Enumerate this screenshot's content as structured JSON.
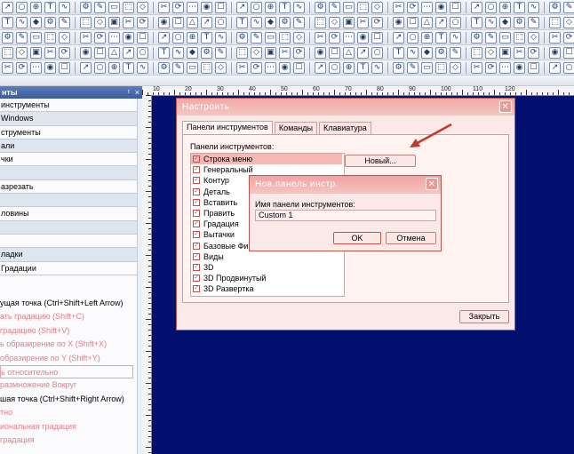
{
  "toolbars": [
    {
      "row": 1,
      "icons": [
        "drawing-icon",
        "arrow-icon",
        "circle-icon",
        "globe-icon",
        "text-icon",
        "wave-icon",
        "bucket-icon",
        "link-icon",
        "curve-icon"
      ]
    },
    {
      "row": 2,
      "icons": [
        "brush-icon",
        "pen-icon",
        "shape-icon",
        "pencil-icon",
        "grid-icon",
        "select-icon"
      ]
    },
    {
      "row": 3,
      "icons": [
        "film-icon",
        "layers-icon",
        "export-icon",
        "grid-icon",
        "star-icon"
      ]
    },
    {
      "row": 4,
      "icons": [
        "cross-icon",
        "table-icon",
        "window-icon",
        "frame-icon"
      ]
    }
  ],
  "left_panel": {
    "header": "нты",
    "pin": "ᵗ",
    "close": "×",
    "rows": [
      {
        "label": "инструменты"
      },
      {
        "label": "Windows"
      },
      {
        "label": "струменты"
      },
      {
        "label": "али"
      },
      {
        "label": "чки"
      },
      {
        "label": ""
      },
      {
        "label": "азрезать"
      },
      {
        "label": ""
      },
      {
        "label": "ловины"
      },
      {
        "label": ""
      },
      {
        "label": ""
      },
      {
        "label": "ладки"
      },
      {
        "label": "Градации"
      }
    ],
    "commands": [
      {
        "label": "ущая точка (Ctrl+Shift+Left Arrow)",
        "state": "normal"
      },
      {
        "label": "ать градацию (Shift+C)",
        "state": "dim"
      },
      {
        "label": "градацию (Shift+V)",
        "state": "dim"
      },
      {
        "label": "ь образирение по X (Shift+X)",
        "state": "dim"
      },
      {
        "label": "образирение по Y (Shift+Y)",
        "state": "dim"
      },
      {
        "label": "ь относительно",
        "state": "selected"
      },
      {
        "label": "размножение Вокруг",
        "state": "dim"
      },
      {
        "label": "шая точка (Ctrl+Shift+Right Arrow)",
        "state": "normal"
      },
      {
        "label": "тно",
        "state": "dim"
      },
      {
        "label": "иональная градация",
        "state": "dim"
      },
      {
        "label": "градация",
        "state": "dim"
      }
    ]
  },
  "ruler": {
    "numbers": [
      "10",
      "20",
      "30",
      "40",
      "50",
      "60",
      "70",
      "80",
      "90",
      "100",
      "110",
      "120"
    ]
  },
  "dialog": {
    "title": "Настроить",
    "close": "✕",
    "tabs": [
      "Панели инструментов",
      "Команды",
      "Клавиатура"
    ],
    "panels_label": "Панели инструментов:",
    "toolbars": [
      "Строка меню",
      "Генеральный",
      "Контур",
      "Деталь",
      "Вставить",
      "Править",
      "Градация",
      "Вытачки",
      "Базовые Фигуры",
      "Виды",
      "3D",
      "3D Продвинутый",
      "3D Развертка"
    ],
    "new_button": "Новый...",
    "close_button": "Закрыть"
  },
  "subdialog": {
    "title": "Нов.панель инстр.",
    "close": "✕",
    "label": "Имя панели инструментов:",
    "value": "Custom 1",
    "ok": "OK",
    "cancel": "Отмена"
  },
  "colors": {
    "canvas": "#041070",
    "accent": "#c0392b"
  }
}
